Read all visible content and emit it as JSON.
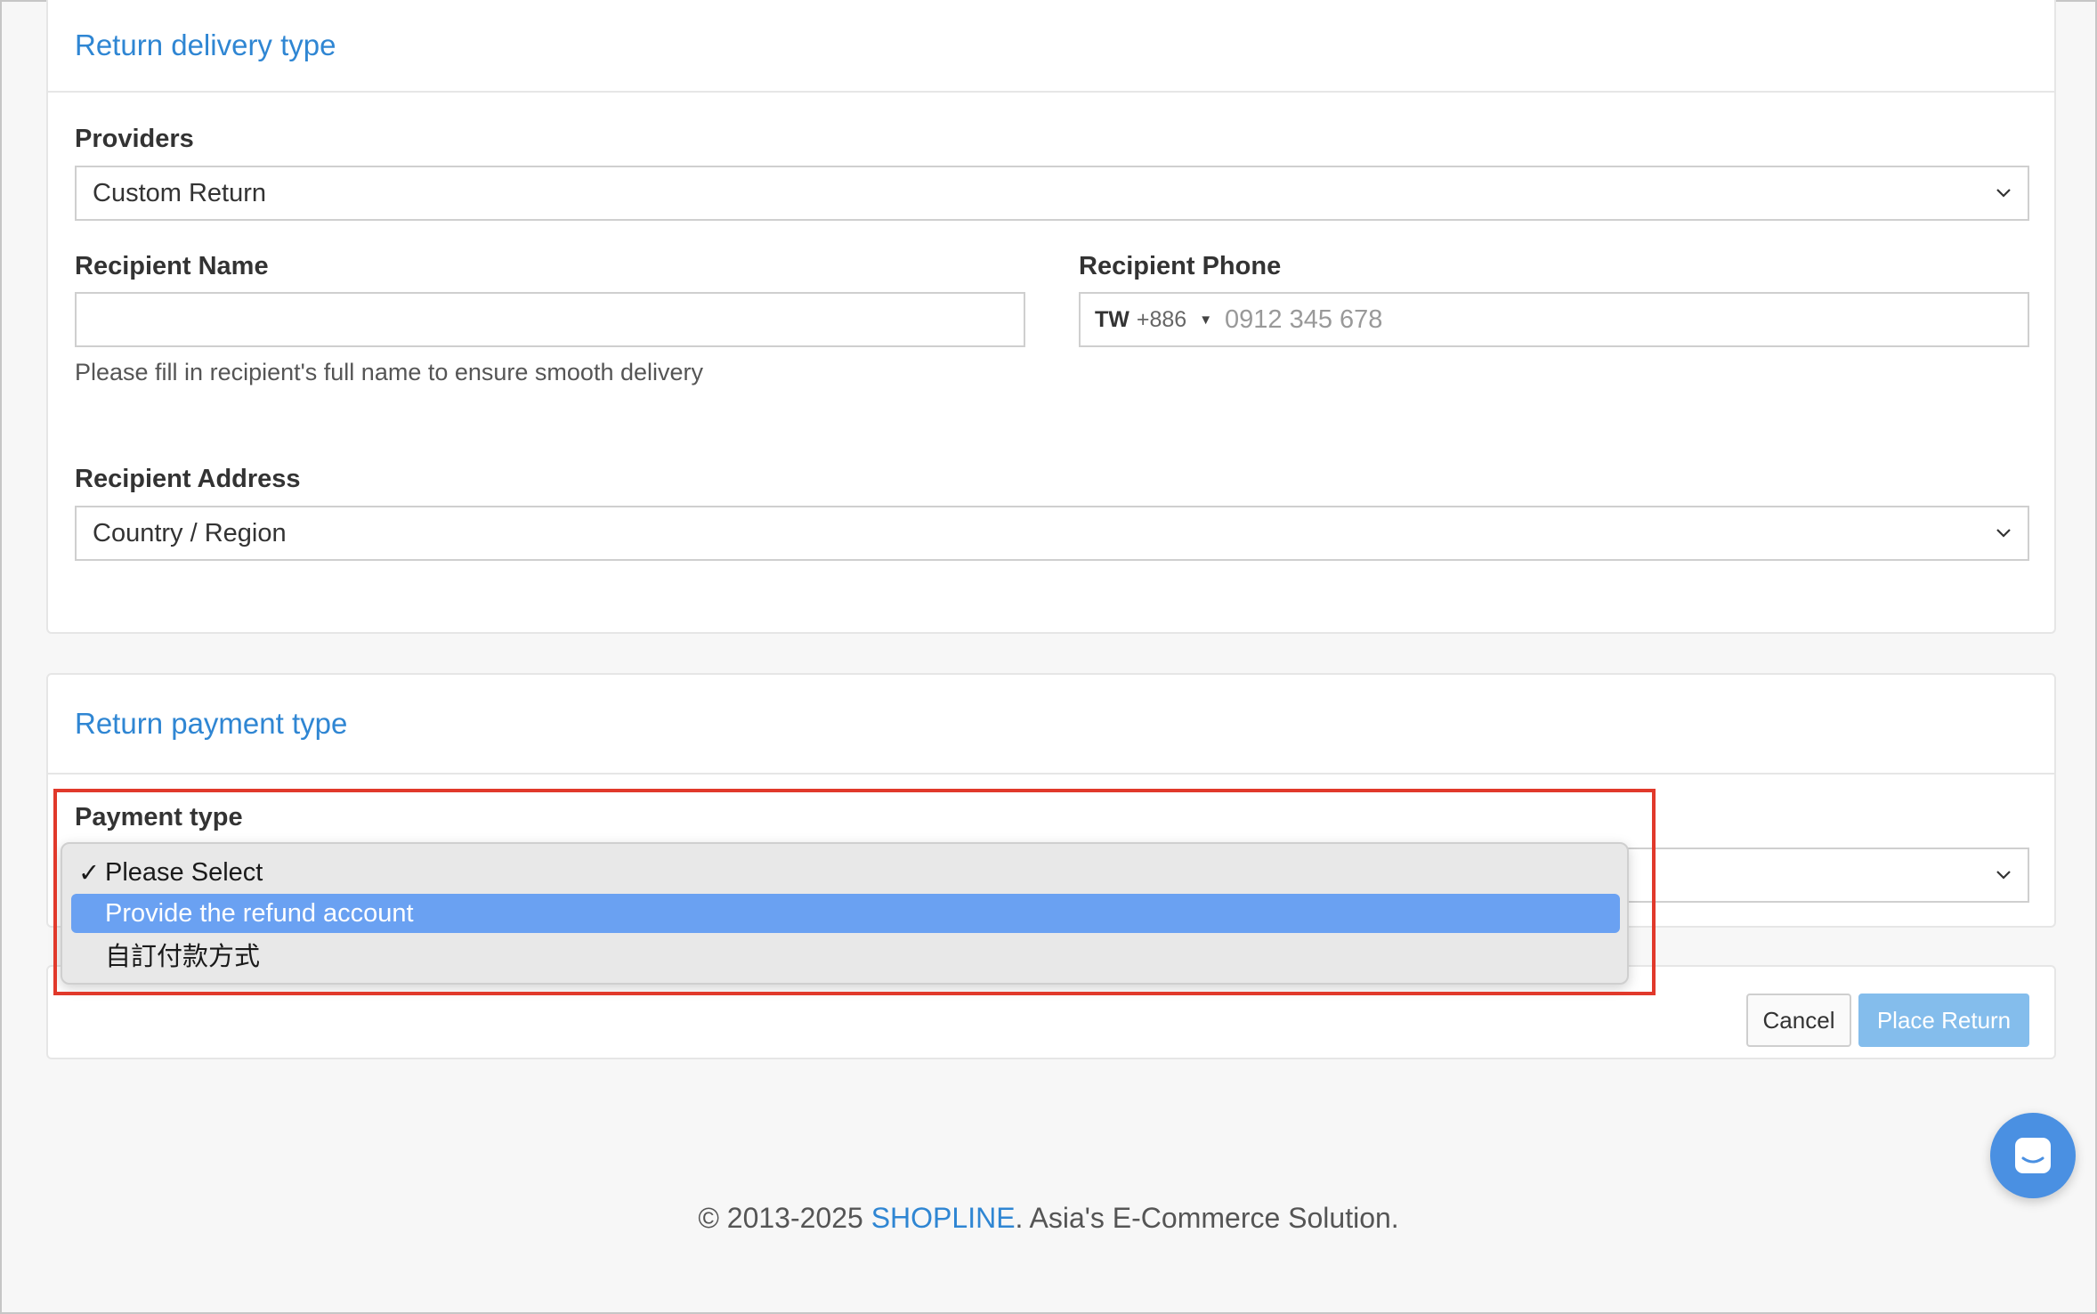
{
  "delivery": {
    "title": "Return delivery type",
    "providers_label": "Providers",
    "providers_value": "Custom Return",
    "recipient_name_label": "Recipient Name",
    "recipient_name_value": "",
    "recipient_name_hint": "Please fill in recipient's full name to ensure smooth delivery",
    "recipient_phone_label": "Recipient Phone",
    "phone_country_code": "TW",
    "phone_dial_code": "+886",
    "phone_placeholder": "0912 345 678",
    "recipient_address_label": "Recipient Address",
    "country_region_value": "Country / Region"
  },
  "payment": {
    "title": "Return payment type",
    "payment_type_label": "Payment type",
    "options": [
      {
        "label": "Please Select",
        "checked": true,
        "highlighted": false
      },
      {
        "label": "Provide the refund account",
        "checked": false,
        "highlighted": true
      },
      {
        "label": "自訂付款方式",
        "checked": false,
        "highlighted": false
      }
    ],
    "check_mark": "✓"
  },
  "actions": {
    "cancel_label": "Cancel",
    "place_return_label": "Place Return"
  },
  "footer": {
    "prefix": "© 2013-2025 ",
    "brand": "SHOPLINE",
    "suffix": ". Asia's E-Commerce Solution."
  },
  "colors": {
    "accent": "#2f86d3",
    "highlight_border": "#e1392b",
    "selected_option": "#6aa1f2",
    "primary_button": "#84bdec",
    "chat_button": "#4a90e2"
  },
  "icons": {
    "select_arrow": "chevron-down-icon",
    "chat": "chat-icon"
  }
}
